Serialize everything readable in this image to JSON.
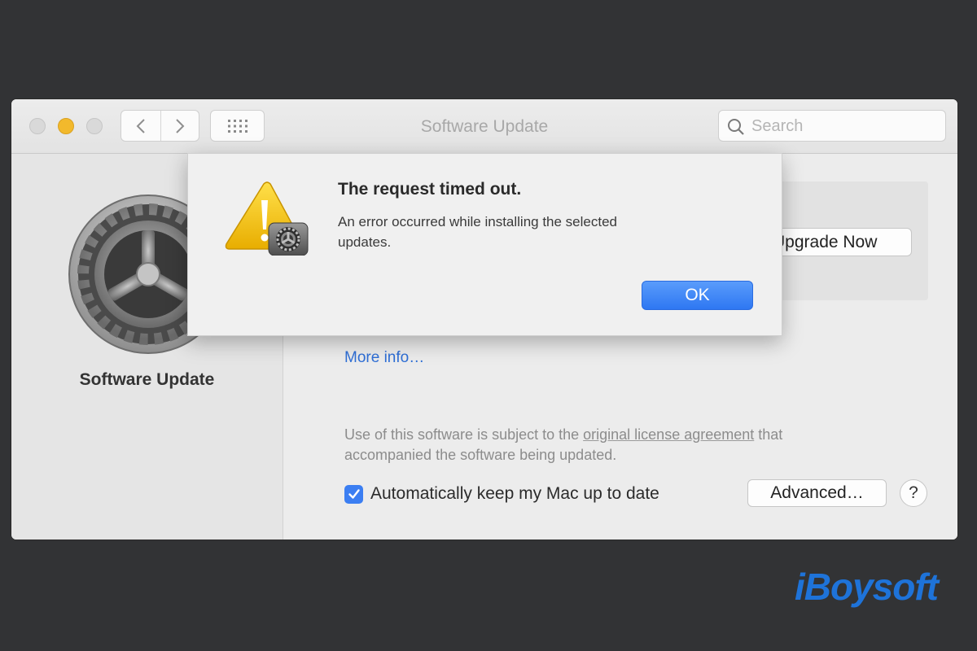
{
  "window": {
    "title": "Software Update",
    "search_placeholder": "Search"
  },
  "sidebar": {
    "title": "Software Update",
    "icon": "gear-icon"
  },
  "main": {
    "upgrade_button": "Upgrade Now",
    "more_info_link": "More info…",
    "license_prefix": "Use of this software is subject to the ",
    "license_link": "original license agreement",
    "license_suffix": " that accompanied the software being updated.",
    "auto_update_label": "Automatically keep my Mac up to date",
    "auto_update_checked": true,
    "advanced_button": "Advanced…",
    "help_button": "?"
  },
  "dialog": {
    "title": "The request timed out.",
    "message": "An error occurred while installing the selected updates.",
    "ok_button": "OK",
    "icon": "warning-icon"
  },
  "watermark": "iBoysoft",
  "colors": {
    "accent": "#3b7ef2",
    "link": "#2f6fd6",
    "warning": "#f5c400",
    "background": "#323335",
    "watermark": "#1e73d9"
  }
}
